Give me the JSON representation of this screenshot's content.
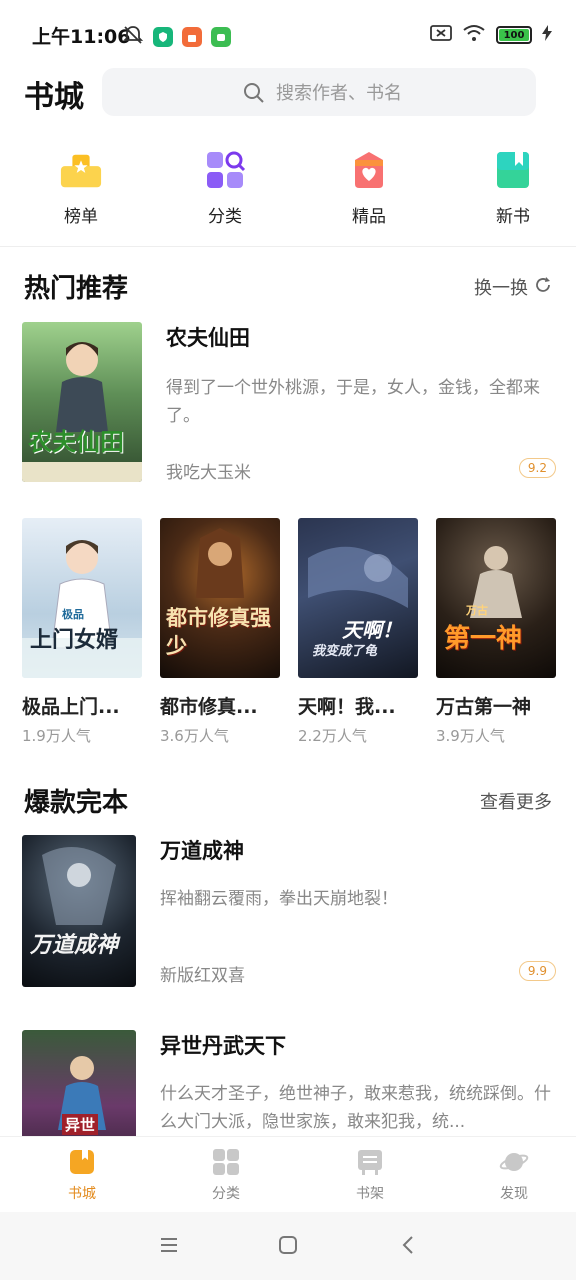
{
  "status_bar": {
    "time": "上午11:06",
    "battery": "100"
  },
  "header": {
    "title": "书城",
    "search_placeholder": "搜索作者、书名"
  },
  "quick_nav": [
    {
      "label": "榜单",
      "icon": "ranking-icon"
    },
    {
      "label": "分类",
      "icon": "category-icon"
    },
    {
      "label": "精品",
      "icon": "premium-icon"
    },
    {
      "label": "新书",
      "icon": "new-book-icon"
    }
  ],
  "hot": {
    "title": "热门推荐",
    "action": "换一换",
    "featured": {
      "title": "农夫仙田",
      "desc": "得到了一个世外桃源，于是，女人，金钱，全都来了。",
      "author": "我吃大玉米",
      "rating": "9.2",
      "cover_text": "农夫仙田"
    },
    "grid": [
      {
        "title": "极品上门...",
        "popularity": "1.9万人气",
        "cover_text": "上门女婿",
        "cover_sub": "极品"
      },
      {
        "title": "都市修真...",
        "popularity": "3.6万人气",
        "cover_text": "都市修真强少",
        "cover_sub": ""
      },
      {
        "title": "天啊！我...",
        "popularity": "2.2万人气",
        "cover_text": "天啊！",
        "cover_sub": "我变成了龟"
      },
      {
        "title": "万古第一神",
        "popularity": "3.9万人气",
        "cover_text": "第一神",
        "cover_sub": "万古"
      }
    ]
  },
  "complete": {
    "title": "爆款完本",
    "action": "查看更多",
    "books": [
      {
        "title": "万道成神",
        "desc": "挥袖翻云覆雨，拳出天崩地裂！",
        "author": "新版红双喜",
        "rating": "9.9",
        "cover_text": "万道成神"
      },
      {
        "title": "异世丹武天下",
        "desc": "什么天才圣子，绝世神子，敢来惹我，统统踩倒。什么大门大派，隐世家族，敢来犯我，统...",
        "cover_text": "异世"
      }
    ]
  },
  "tabs": [
    {
      "label": "书城",
      "active": true
    },
    {
      "label": "分类",
      "active": false
    },
    {
      "label": "书架",
      "active": false
    },
    {
      "label": "发现",
      "active": false
    }
  ],
  "colors": {
    "accent": "#e38b1e",
    "rating_border": "#f3c98a"
  }
}
